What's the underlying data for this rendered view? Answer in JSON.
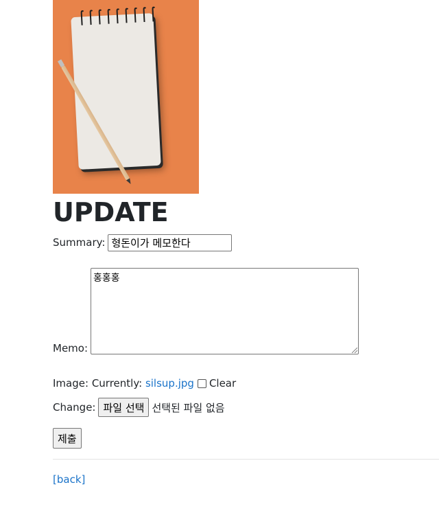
{
  "page": {
    "heading": "UPDATE"
  },
  "form": {
    "summary_label": "Summary:",
    "summary_value": "형돈이가 메모한다",
    "memo_label": "Memo:",
    "memo_value": "홍홍홍",
    "image_label": "Image:",
    "currently_label": "Currently:",
    "current_file": "silsup.jpg",
    "clear_label": "Clear",
    "clear_checked": false,
    "change_label": "Change:",
    "file_button_label": "파일 선택",
    "file_status": "선택된 파일 없음",
    "submit_label": "제출"
  },
  "footer": {
    "back_link": "[back]"
  },
  "colors": {
    "photo_background": "#e8834a",
    "link": "#1a73c9"
  },
  "image": {
    "subject": "notepad-with-pencil"
  }
}
